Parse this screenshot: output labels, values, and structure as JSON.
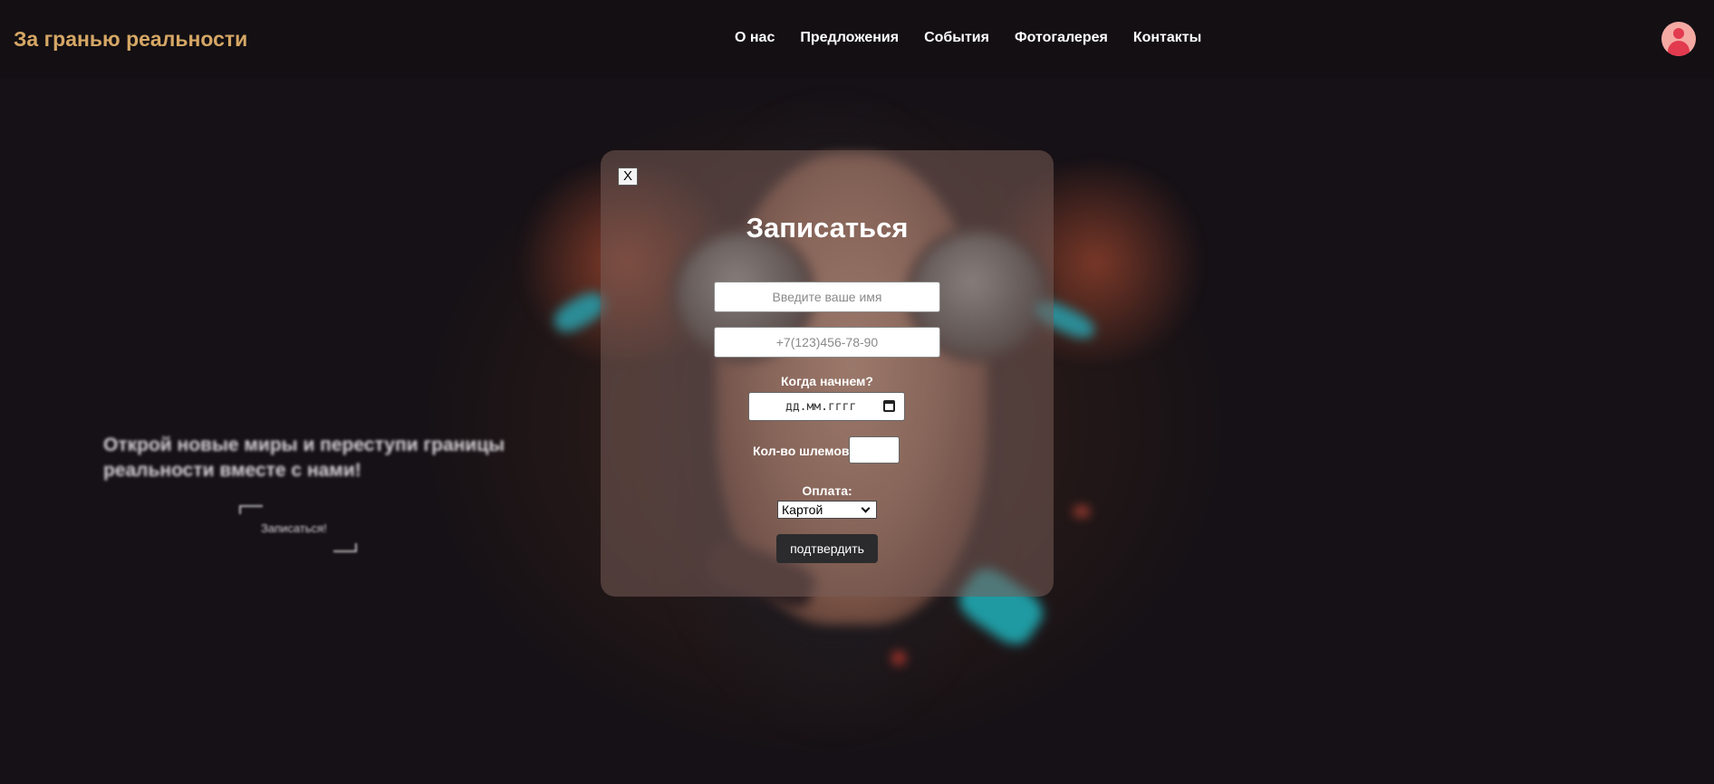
{
  "header": {
    "logo": "За гранью реальности",
    "nav": [
      "О нас",
      "Предложения",
      "События",
      "Фотогалерея",
      "Контакты"
    ]
  },
  "hero": {
    "text": "Открой новые миры и переступи границы реальности вместе с нами!",
    "button_label": "Записаться!"
  },
  "modal": {
    "close_label": "X",
    "title": "Записаться",
    "name_placeholder": "Введите ваше имя",
    "phone_placeholder": "+7(123)456-78-90",
    "date_label": "Когда начнем?",
    "date_placeholder": "дд.мм.гггг",
    "helmets_label": "Кол-во шлемов:",
    "payment_label": "Оплата:",
    "payment_selected": "Картой",
    "submit_label": "подтвердить"
  },
  "colors": {
    "logo": "#d6a765",
    "background": "#161116",
    "submit_button": "#2b2b2d",
    "avatar_bg": "#f4a9a3",
    "avatar_fg": "#e23a4e"
  }
}
